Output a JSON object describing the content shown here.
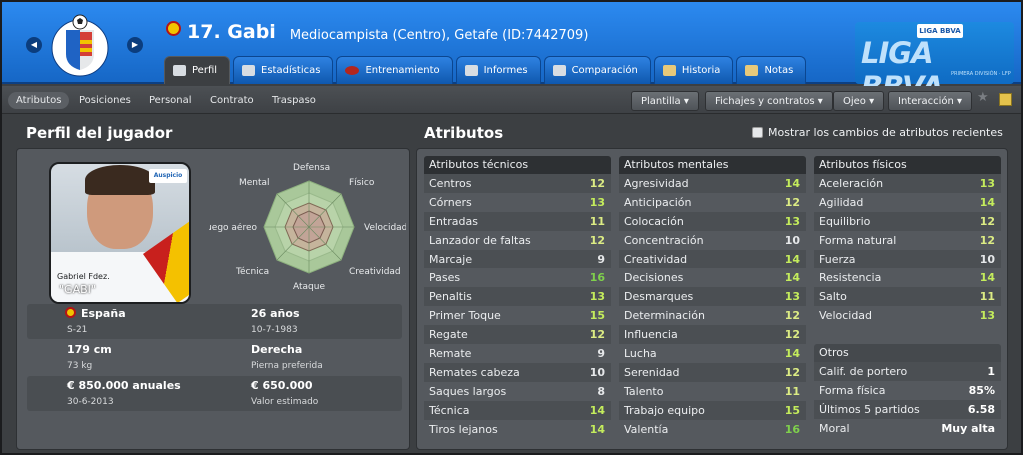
{
  "header": {
    "number_name": "17. Gabi",
    "position_club": "Mediocampista (Centro), Getafe (ID:7442709)",
    "tabs": [
      "Perfil",
      "Estadísticas",
      "Entrenamiento",
      "Informes",
      "Comparación",
      "Historia",
      "Notas"
    ],
    "active_tab": "Perfil",
    "crest_text": "GETAFE C.F. S.A.D.",
    "league_logo": {
      "top": "LIGA BBVA",
      "main": "LIGA BBVA",
      "bottom": "PRIMERA DIVISIÓN · LFP"
    }
  },
  "subtabs": [
    "Atributos",
    "Posiciones",
    "Personal",
    "Contrato",
    "Traspaso"
  ],
  "active_subtab": "Atributos",
  "toolbar": {
    "dropdowns": [
      "Plantilla",
      "Fichajes y contratos",
      "Ojeo",
      "Interacción"
    ]
  },
  "profile": {
    "title": "Perfil del jugador",
    "photo_name": "Gabriel Fdez.",
    "photo_nick": "\"GABI\"",
    "photo_logo": "Auspicio",
    "radar_labels": {
      "defensa": "Defensa",
      "fisico": "Físico",
      "velocidad": "Velocidad",
      "creatividad": "Creatividad",
      "ataque": "Ataque",
      "tecnica": "Técnica",
      "juego_aereo": "Juego aéreo",
      "mental": "Mental"
    },
    "info": [
      {
        "left_value": "España",
        "left_label": "S-21",
        "right_value": "26 años",
        "right_label": "10-7-1983"
      },
      {
        "left_value": "179 cm",
        "left_label": "73 kg",
        "right_value": "Derecha",
        "right_label": "Pierna preferida"
      },
      {
        "left_value": "€ 850.000 anuales",
        "left_label": "30-6-2013",
        "right_value": "€ 650.000",
        "right_label": "Valor estimado"
      }
    ]
  },
  "attributes": {
    "title": "Atributos",
    "show_changes_label": "Mostrar los cambios de atributos recientes",
    "technical": {
      "title": "Atributos técnicos",
      "items": [
        [
          "Centros",
          "12"
        ],
        [
          "Córners",
          "13"
        ],
        [
          "Entradas",
          "11"
        ],
        [
          "Lanzador de faltas",
          "12"
        ],
        [
          "Marcaje",
          "9"
        ],
        [
          "Pases",
          "16"
        ],
        [
          "Penaltis",
          "13"
        ],
        [
          "Primer Toque",
          "15"
        ],
        [
          "Regate",
          "12"
        ],
        [
          "Remate",
          "9"
        ],
        [
          "Remates cabeza",
          "10"
        ],
        [
          "Saques largos",
          "8"
        ],
        [
          "Técnica",
          "14"
        ],
        [
          "Tiros lejanos",
          "14"
        ]
      ]
    },
    "mental": {
      "title": "Atributos mentales",
      "items": [
        [
          "Agresividad",
          "14"
        ],
        [
          "Anticipación",
          "12"
        ],
        [
          "Colocación",
          "13"
        ],
        [
          "Concentración",
          "10"
        ],
        [
          "Creatividad",
          "14"
        ],
        [
          "Decisiones",
          "14"
        ],
        [
          "Desmarques",
          "13"
        ],
        [
          "Determinación",
          "12"
        ],
        [
          "Influencia",
          "12"
        ],
        [
          "Lucha",
          "14"
        ],
        [
          "Serenidad",
          "12"
        ],
        [
          "Talento",
          "11"
        ],
        [
          "Trabajo equipo",
          "15"
        ],
        [
          "Valentía",
          "16"
        ]
      ]
    },
    "physical": {
      "title": "Atributos físicos",
      "items": [
        [
          "Aceleración",
          "13"
        ],
        [
          "Agilidad",
          "14"
        ],
        [
          "Equilibrio",
          "12"
        ],
        [
          "Forma natural",
          "12"
        ],
        [
          "Fuerza",
          "10"
        ],
        [
          "Resistencia",
          "14"
        ],
        [
          "Salto",
          "11"
        ],
        [
          "Velocidad",
          "13"
        ]
      ]
    },
    "other": {
      "title": "Otros",
      "items": [
        [
          "Calif. de portero",
          "1"
        ],
        [
          "Forma física",
          "85%"
        ],
        [
          "Últimos 5 partidos",
          "6.58"
        ],
        [
          "Moral",
          "Muy alta"
        ]
      ]
    }
  }
}
